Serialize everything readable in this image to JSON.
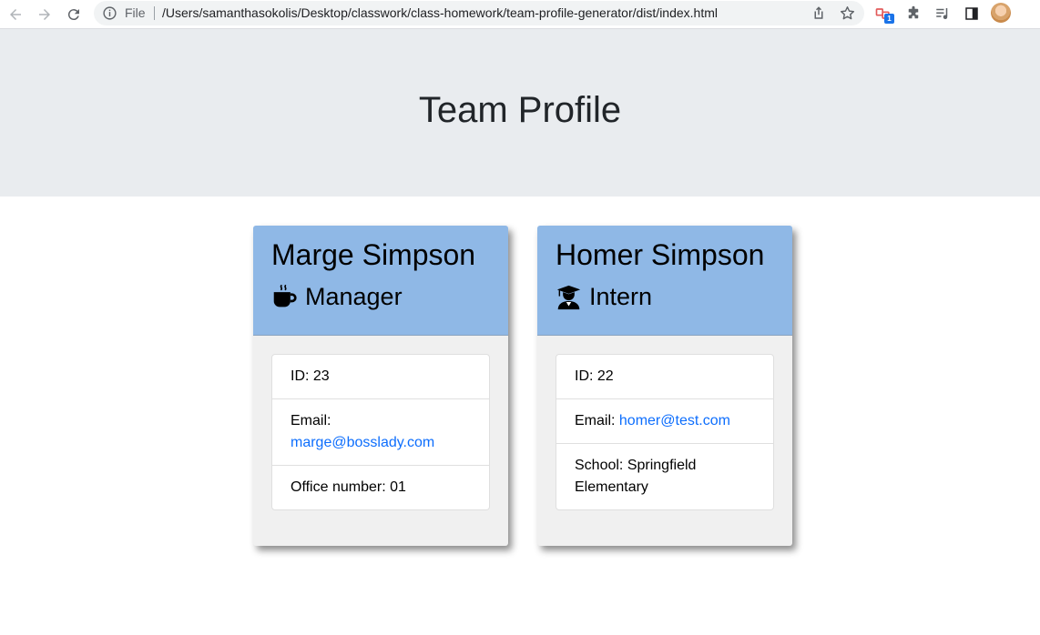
{
  "browser": {
    "file_label": "File",
    "url": "/Users/samanthasokolis/Desktop/classwork/class-homework/team-profile-generator/dist/index.html",
    "extension_badge": "1"
  },
  "page": {
    "title": "Team Profile"
  },
  "cards": [
    {
      "name": "Marge Simpson",
      "role": "Manager",
      "role_icon": "coffee-mug-icon",
      "id_label": "ID: 23",
      "email_label": "Email:",
      "email": "marge@bosslady.com",
      "extra_label": "Office number: 01"
    },
    {
      "name": "Homer Simpson",
      "role": "Intern",
      "role_icon": "graduate-icon",
      "id_label": "ID: 22",
      "email_label": "Email:",
      "email": "homer@test.com",
      "extra_label": "School: Springfield Elementary"
    }
  ],
  "colors": {
    "header_bg": "#e9ecef",
    "card_header": "#8fb8e6",
    "card_body": "#f0f0f0",
    "link": "#0d6efd"
  }
}
